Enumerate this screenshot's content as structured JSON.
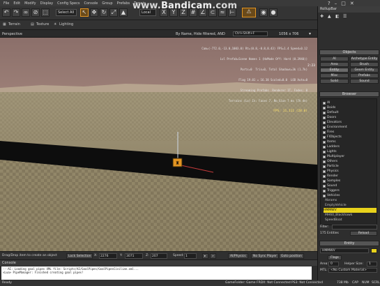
{
  "menu": {
    "items": [
      "File",
      "Edit",
      "Modify",
      "Display",
      "Config Specs",
      "Console",
      "Group",
      "Prefabs",
      "Terrain"
    ]
  },
  "toolbar": {
    "select_combo": "Select All",
    "local_combo": "Local",
    "top_labels": [
      "Snap To",
      "Snap",
      "Center",
      "Pivot Grid",
      "Snap Grid",
      "Trans Grid",
      "Snap Rot",
      "Scale"
    ]
  },
  "toolbar2": {
    "terrain": "Terrain",
    "texture": "Texture",
    "lighting": "Lighting"
  },
  "viewport_header": {
    "title": "Perspective",
    "filter": "By Name, Hide filtered, AND",
    "search": "Ctrl+Shift+F",
    "resolution": "1056 x 706"
  },
  "hud": {
    "lines": [
      "Cam=(-772.0,-13.0,1003.0) Rt=(0.8,-0.8,8.43) FPS=1.4 Speed=0.12",
      "Lvl Prefab=Scene Homes 1 (HoMode Off: Hard (0.3940))",
      "Parts=0  Tris=0, Total Shadows=3k (1.7k)",
      "Flag 19.01 = 16.38 Scaled=0.0  LOD Auto=0",
      "Streaming Prefabs  Renderer 1T, Fades: 0",
      "Terrains (Lo) In: Faces 7, No_Glue 7 ms (7k 4e)"
    ],
    "fps": "FPS: 11.111 (28.0)",
    "timer": "2:23"
  },
  "watermark": {
    "pre": "www.",
    "brand": "Bandicam",
    "post": ".com"
  },
  "statusbar": {
    "hint": "Drag/Drop item to create an object",
    "lock": "Lock Selection",
    "x_label": "X:",
    "x_value": "2276",
    "y_label": "Y:",
    "y_value": "3071",
    "z_label": "Z:",
    "z_value": "207",
    "speed_label": "Speed:",
    "speed_value": "1",
    "buttons": [
      "AI/Physics",
      "No Sync Player",
      "Goto position"
    ]
  },
  "console": {
    "title": "Console",
    "lines": [
      "---AI: Loading goal pipes XML file: Scripts/AI/GoalPipes/GoalPipesCivilian.xml...",
      "<Lua> PipeManager: Finished creating goal pipes!"
    ]
  },
  "bottombar": {
    "left": "Ready",
    "items": [
      "GameFolder: Game",
      "FRDX: Not Connected",
      "PS3: Not Connected",
      "738 Mb",
      "CAP",
      "NUM",
      "SCRL"
    ]
  },
  "rollup": {
    "title": "RollupBar",
    "objects_header": "Objects",
    "object_buttons": [
      "AI",
      "Archetype Entity",
      "Area",
      "Brush",
      "Entity",
      "Geom Entity",
      "Misc",
      "Prefabs",
      "Solid",
      "Sound"
    ],
    "selected_object": "Entity",
    "browser_header": "Browser",
    "browser_items": [
      "AI",
      "Boids",
      "Default",
      "Doors",
      "Elevators",
      "Environment",
      "Fires",
      "FlObjects",
      "Items",
      "Ladders",
      "Lights",
      "Multiplayer",
      "Others",
      "Particle",
      "Physics",
      "Render",
      "Samples",
      "Sound",
      "Triggers",
      "Vehicles"
    ],
    "vehicle_children": [
      "Abrams",
      "EmptyVehicle",
      "HMMWV",
      "MH60_Blackhawk",
      "SpeedBoat"
    ],
    "selected_vehicle": "HMMWV",
    "filter_label": "Filter:",
    "entities_count": "175 Entities",
    "reload": "Reload",
    "entity_header": "Entity",
    "entity_name": "HMMWV",
    "flags": "Flags",
    "area_label": "Area:",
    "area_value": "0",
    "helper_label": "Helper Size:",
    "helper_value": "1",
    "mtl_label": "MTL:",
    "mtl_value": "<No Custom Material>"
  },
  "colors": {
    "highlight": "#e8d21b",
    "accent_orange": "#e29422"
  }
}
